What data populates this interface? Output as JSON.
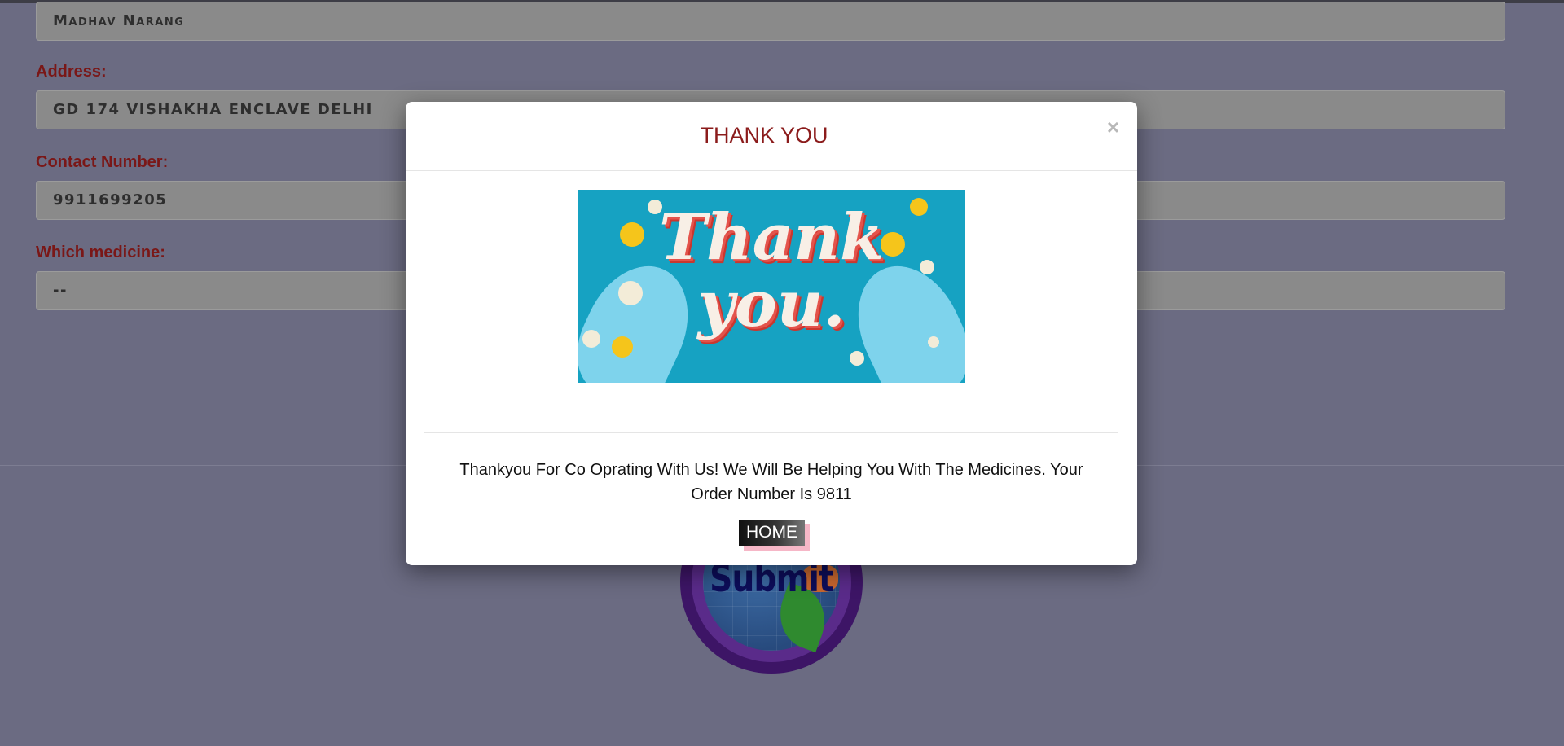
{
  "form": {
    "name_value": "Madhav Narang",
    "address_label": "Address:",
    "address_value": "GD 174 VISHAKHA ENCLAVE DELHI",
    "contact_label": "Contact Number:",
    "contact_value": "9911699205",
    "medicine_label": "Which medicine:",
    "medicine_value": "--",
    "submit_label": "Submit"
  },
  "modal": {
    "title": "THANK YOU",
    "close_symbol": "×",
    "banner_text": "Thank you.",
    "message": "Thankyou For Co Oprating With Us! We Will Be Helping You With The Medicines. Your Order Number Is 9811",
    "home_button": "HOME"
  },
  "colors": {
    "overlay_background": "#6b6b82",
    "label_color": "#7a1717",
    "title_color": "#8b1b1b",
    "banner_background": "#16a2c2"
  }
}
